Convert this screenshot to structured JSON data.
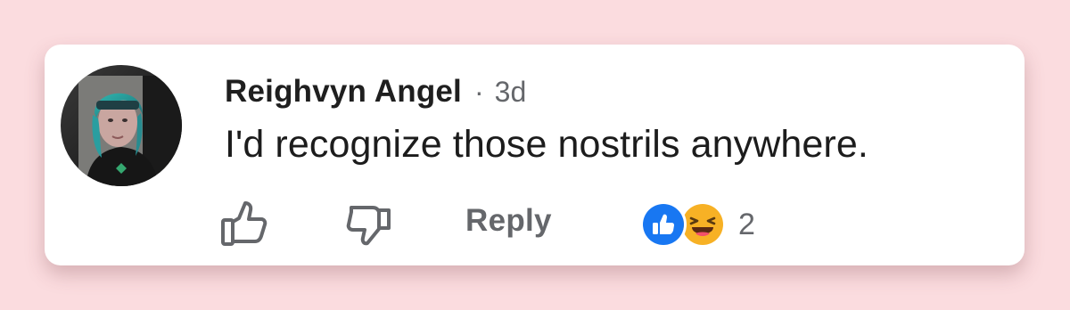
{
  "comment": {
    "author": "Reighvyn Angel",
    "separator": "·",
    "time": "3d",
    "text": "I'd recognize those nostrils anywhere."
  },
  "actions": {
    "like_icon": "thumbs-up-icon",
    "dislike_icon": "thumbs-down-icon",
    "reply_label": "Reply"
  },
  "reactions": {
    "types": [
      "like",
      "haha"
    ],
    "count": "2"
  },
  "colors": {
    "background": "#fbdcdf",
    "card": "#ffffff",
    "text": "#1c1c1c",
    "muted": "#65676b",
    "like_blue": "#1877f2",
    "haha_yellow": "#f7b125"
  }
}
